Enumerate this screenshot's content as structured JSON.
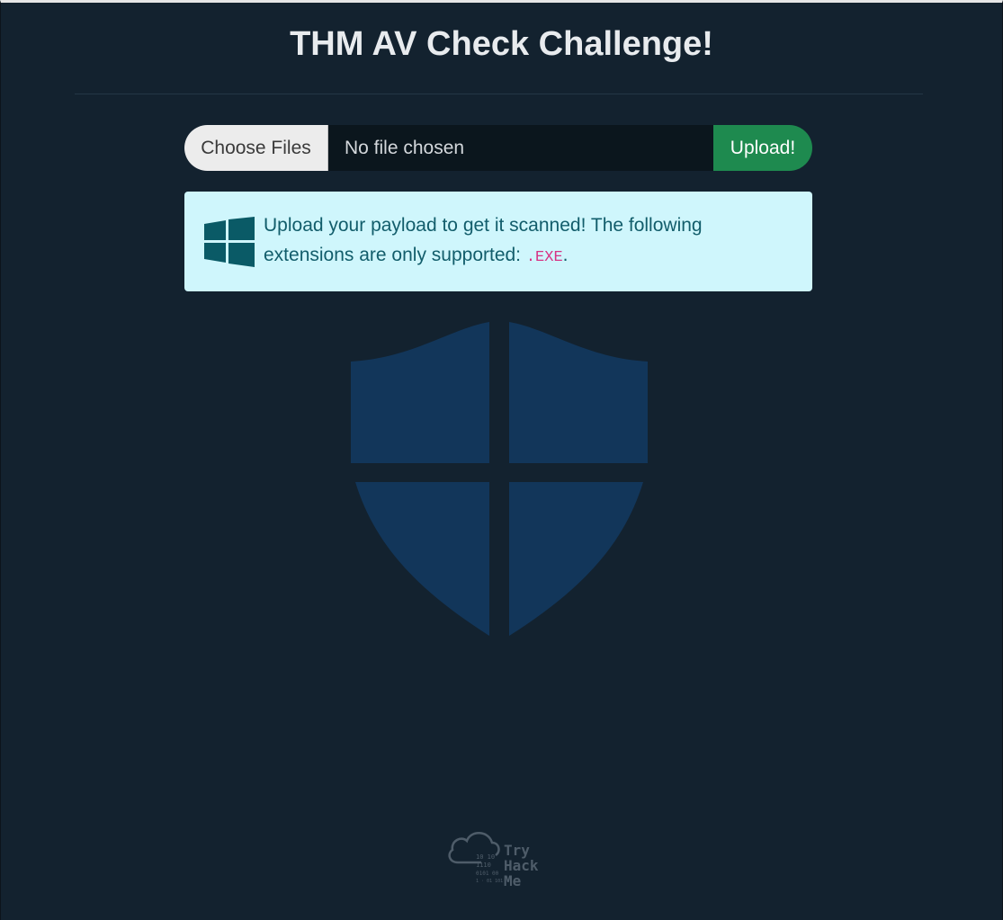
{
  "header": {
    "title": "THM AV Check Challenge!"
  },
  "upload": {
    "choose_label": "Choose Files",
    "file_status": "No file chosen",
    "submit_label": "Upload!"
  },
  "info": {
    "text_before": "Upload your payload to get it scanned! The following extensions are only supported: ",
    "extension": ".EXE",
    "text_after": "."
  },
  "logo": {
    "word_1": "Try",
    "word_2": "Hack",
    "word_3": "Me"
  },
  "colors": {
    "background": "#13222f",
    "accent_green": "#1e8a4f",
    "info_bg": "#cff6fc",
    "info_text": "#125d6b",
    "code_pink": "#d63384",
    "shield": "#12365a"
  },
  "icons": {
    "info": "windows-icon",
    "background": "shield-icon",
    "footer": "tryhackme-logo"
  }
}
